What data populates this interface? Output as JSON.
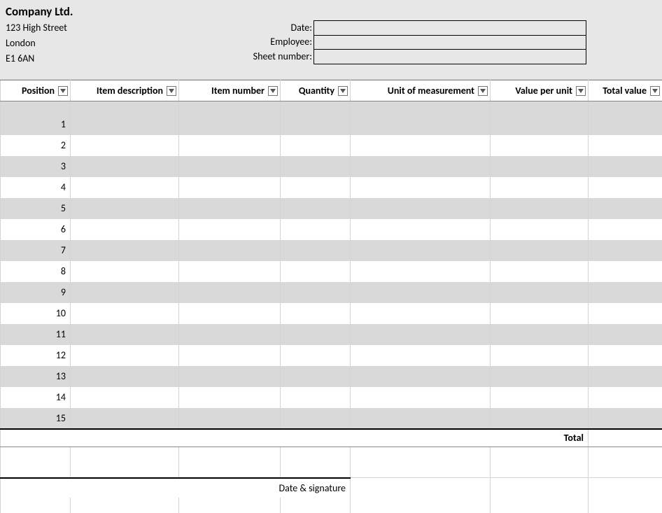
{
  "company": {
    "name": "Company Ltd.",
    "street": "123 High Street",
    "city": "London",
    "postcode": "E1 6AN"
  },
  "fields": {
    "date_label": "Date:",
    "date_value": "",
    "employee_label": "Employee:",
    "employee_value": "",
    "sheet_label": "Sheet number:",
    "sheet_value": ""
  },
  "columns": {
    "position": "Position",
    "description": "Item description",
    "item_number": "Item number",
    "quantity": "Quantity",
    "uom": "Unit of measurement",
    "vpu": "Value per unit",
    "total": "Total value"
  },
  "rows": [
    {
      "position": "1",
      "description": "",
      "item_number": "",
      "quantity": "",
      "uom": "",
      "vpu": "",
      "total": ""
    },
    {
      "position": "2",
      "description": "",
      "item_number": "",
      "quantity": "",
      "uom": "",
      "vpu": "",
      "total": ""
    },
    {
      "position": "3",
      "description": "",
      "item_number": "",
      "quantity": "",
      "uom": "",
      "vpu": "",
      "total": ""
    },
    {
      "position": "4",
      "description": "",
      "item_number": "",
      "quantity": "",
      "uom": "",
      "vpu": "",
      "total": ""
    },
    {
      "position": "5",
      "description": "",
      "item_number": "",
      "quantity": "",
      "uom": "",
      "vpu": "",
      "total": ""
    },
    {
      "position": "6",
      "description": "",
      "item_number": "",
      "quantity": "",
      "uom": "",
      "vpu": "",
      "total": ""
    },
    {
      "position": "7",
      "description": "",
      "item_number": "",
      "quantity": "",
      "uom": "",
      "vpu": "",
      "total": ""
    },
    {
      "position": "8",
      "description": "",
      "item_number": "",
      "quantity": "",
      "uom": "",
      "vpu": "",
      "total": ""
    },
    {
      "position": "9",
      "description": "",
      "item_number": "",
      "quantity": "",
      "uom": "",
      "vpu": "",
      "total": ""
    },
    {
      "position": "10",
      "description": "",
      "item_number": "",
      "quantity": "",
      "uom": "",
      "vpu": "",
      "total": ""
    },
    {
      "position": "11",
      "description": "",
      "item_number": "",
      "quantity": "",
      "uom": "",
      "vpu": "",
      "total": ""
    },
    {
      "position": "12",
      "description": "",
      "item_number": "",
      "quantity": "",
      "uom": "",
      "vpu": "",
      "total": ""
    },
    {
      "position": "13",
      "description": "",
      "item_number": "",
      "quantity": "",
      "uom": "",
      "vpu": "",
      "total": ""
    },
    {
      "position": "14",
      "description": "",
      "item_number": "",
      "quantity": "",
      "uom": "",
      "vpu": "",
      "total": ""
    },
    {
      "position": "15",
      "description": "",
      "item_number": "",
      "quantity": "",
      "uom": "",
      "vpu": "",
      "total": ""
    }
  ],
  "totals": {
    "label": "Total",
    "value": ""
  },
  "signature": {
    "label": "Date & signature"
  }
}
